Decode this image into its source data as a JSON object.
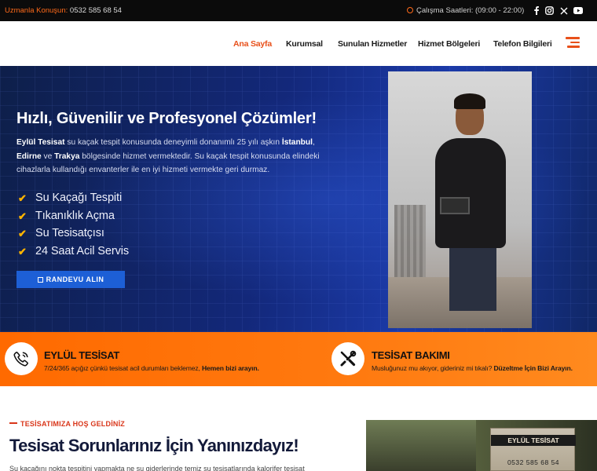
{
  "topbar": {
    "contact_label": "Uzmanla Konuşun:",
    "contact_phone": "0532 585 68 54",
    "hours": "Çalışma Saatleri: (09:00 - 22:00)",
    "social": [
      "facebook-icon",
      "instagram-icon",
      "x-icon",
      "youtube-icon"
    ]
  },
  "nav": {
    "items": [
      "Ana Sayfa",
      "Kurumsal",
      "Sunulan Hizmetler",
      "Hizmet Bölgeleri",
      "Telefon Bilgileri"
    ],
    "active_index": 0,
    "accent_color": "#e8501a"
  },
  "hero": {
    "title": "Hızlı, Güvenilir ve Profesyonel Çözümler!",
    "desc_brand": "Eylül Tesisat",
    "desc_part1": " su kaçak tespit konusunda deneyimli donanımlı 25 yılı aşkın ",
    "desc_city1": "İstanbul",
    "desc_sep": ", ",
    "desc_city2": "Edirne",
    "desc_and": " ve ",
    "desc_city3": "Trakya",
    "desc_part2": " bölgesinde hizmet vermektedir. Su kaçak tespit konusunda elindeki cihazlarla kullandığı envanterler ile en iyi hizmeti vermekte geri durmaz.",
    "checklist": [
      "Su Kaçağı Tespiti",
      "Tıkanıklık Açma",
      "Su Tesisatçısı",
      "24 Saat Acil Servis"
    ],
    "cta_label": "RANDEVU ALIN"
  },
  "band": {
    "card1": {
      "title": "EYLÜL TESİSAT",
      "text": "7/24/365 açığız çünkü tesisat acil durumları beklemez, ",
      "text_bold": "Hemen bizi arayın."
    },
    "card2": {
      "title": "TESİSAT BAKIMI",
      "text": "Musluğunuz mu akıyor, gideriniz mi tıkalı? ",
      "text_bold": "Düzeltme İçin Bizi Arayın."
    }
  },
  "welcome": {
    "tag": "TESİSATIMIZA HOŞ GELDİNİZ",
    "title": "Tesisat Sorunlarınız İçin Yanınızdayız!",
    "body": "Su kaçağını nokta tespitini yapmakta ne su giderlerinde temiz su tesisatlarında kalorifer tesisat"
  },
  "promo": {
    "sign_name": "EYLÜL TESİSAT",
    "sign_phone": "0532 585 68 54"
  }
}
